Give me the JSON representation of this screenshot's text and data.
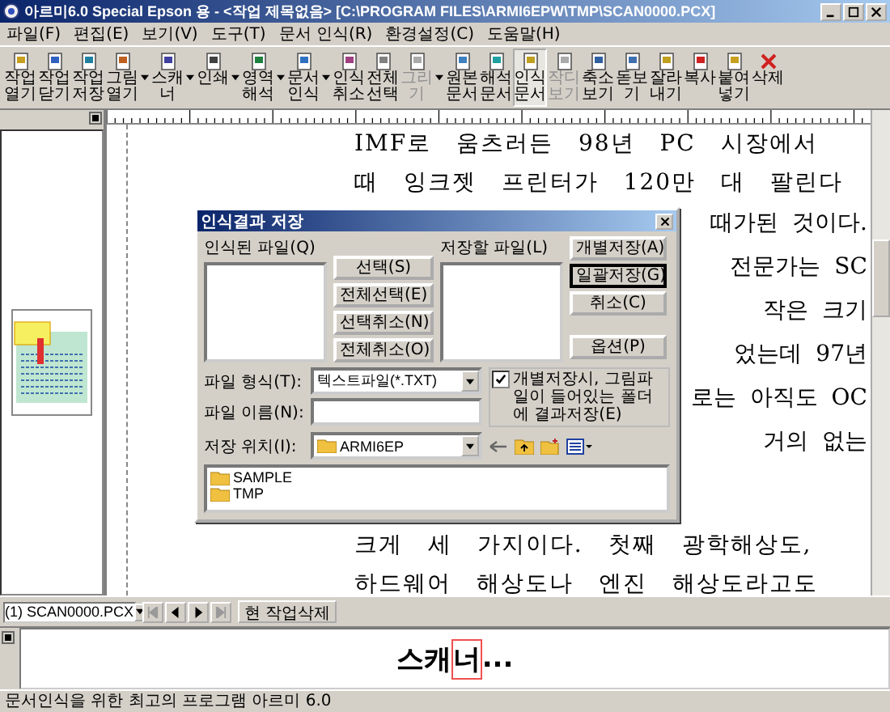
{
  "window": {
    "title": "아르미6.0 Special Epson 용 - <작업 제목없음> [C:\\PROGRAM FILES\\ARMI6EPW\\TMP\\SCAN0000.PCX]"
  },
  "menu": [
    "파일(F)",
    "편집(E)",
    "보기(V)",
    "도구(T)",
    "문서 인식(R)",
    "환경설정(C)",
    "도움말(H)"
  ],
  "toolbar": [
    {
      "kind": "button",
      "label": "작업열기",
      "selected": false,
      "disabled": false
    },
    {
      "kind": "button",
      "label": "작업닫기",
      "selected": false,
      "disabled": false
    },
    {
      "kind": "button",
      "label": "작업저장",
      "selected": false,
      "disabled": false
    },
    {
      "kind": "button",
      "label": "그림열기",
      "selected": false,
      "disabled": false
    },
    {
      "kind": "dropdown"
    },
    {
      "kind": "button",
      "label": "스캐너",
      "selected": false,
      "disabled": false
    },
    {
      "kind": "dropdown"
    },
    {
      "kind": "button",
      "label": "인쇄",
      "selected": false,
      "disabled": false
    },
    {
      "kind": "dropdown"
    },
    {
      "kind": "button",
      "label": "영역해석",
      "selected": false,
      "disabled": false
    },
    {
      "kind": "dropdown"
    },
    {
      "kind": "button",
      "label": "문서인식",
      "selected": false,
      "disabled": false
    },
    {
      "kind": "dropdown"
    },
    {
      "kind": "button",
      "label": "인식취소",
      "selected": false,
      "disabled": false
    },
    {
      "kind": "button",
      "label": "전체선택",
      "selected": false,
      "disabled": false
    },
    {
      "kind": "button",
      "label": "그리기",
      "selected": false,
      "disabled": true
    },
    {
      "kind": "dropdown"
    },
    {
      "kind": "button",
      "label": "원본문서",
      "selected": false,
      "disabled": false
    },
    {
      "kind": "button",
      "label": "해석문서",
      "selected": false,
      "disabled": false
    },
    {
      "kind": "button",
      "label": "인식문서",
      "selected": true,
      "disabled": false
    },
    {
      "kind": "button",
      "label": "작디보기",
      "selected": false,
      "disabled": true
    },
    {
      "kind": "button",
      "label": "축소보기",
      "selected": false,
      "disabled": false
    },
    {
      "kind": "button",
      "label": "돋보기",
      "selected": false,
      "disabled": false
    },
    {
      "kind": "button",
      "label": "잘라내기",
      "selected": false,
      "disabled": false
    },
    {
      "kind": "button",
      "label": "복사",
      "selected": false,
      "disabled": false
    },
    {
      "kind": "button",
      "label": "붙여넣기",
      "selected": false,
      "disabled": false
    },
    {
      "kind": "button",
      "label": "삭제",
      "selected": false,
      "disabled": false
    }
  ],
  "document": {
    "lines": [
      {
        "kind": "full",
        "text": "IMF로 움츠러든 98년 PC 시장에서"
      },
      {
        "kind": "full",
        "text": "때 잉크젯 프린터가 120만 대 팔린다"
      },
      {
        "kind": "right",
        "text": "때가된 것이다."
      },
      {
        "kind": "right",
        "text": "전문가는 SC"
      },
      {
        "kind": "right",
        "text": "작은 크기"
      },
      {
        "kind": "right",
        "text": "었는데 97년"
      },
      {
        "kind": "right",
        "text": "로는 아직도 OC"
      },
      {
        "kind": "right",
        "text": "거의 없는"
      },
      {
        "kind": "full",
        "text": "크게 세 가지이다. 첫째 광학해상도,"
      },
      {
        "kind": "full",
        "text": "하드웨어 해상도나 엔진 해상도라고도"
      }
    ]
  },
  "dialog": {
    "title": "인식결과 저장",
    "recognized_label": "인식된 파일(Q)",
    "save_label": "저장할 파일(L)",
    "middle_buttons": [
      "선택(S)",
      "전체선택(E)",
      "선택취소(N)",
      "전체취소(O)"
    ],
    "right_buttons": [
      {
        "label": "개별저장(A)",
        "default": false
      },
      {
        "label": "일괄저장(G)",
        "default": true
      },
      {
        "label": "취소(C)",
        "default": false
      },
      {
        "label": "옵션(P)",
        "default": false
      }
    ],
    "file_type_label": "파일 형식(T):",
    "file_type": "텍스트파일(*.TXT)",
    "checkbox": {
      "label": "개별저장시, 그림파일이 들어있는 폴더에 결과저장(E)",
      "checked": true
    },
    "file_name_label": "파일 이름(N):",
    "location_label": "저장 위치(I):",
    "location": "ARMI6EP",
    "folders": [
      "SAMPLE",
      "TMP"
    ]
  },
  "pagebar": {
    "file": "(1) SCAN0000.PCX",
    "nav": [
      {
        "kind": "first",
        "disabled": true
      },
      {
        "kind": "prev",
        "disabled": false
      },
      {
        "kind": "next",
        "disabled": false
      },
      {
        "kind": "last",
        "disabled": true
      }
    ],
    "delete_button": "현 작업삭제"
  },
  "result": {
    "before": "스캐",
    "cursor": "너",
    "after": "..."
  },
  "status_bar": "문서인식을 위한 최고의 프로그램 아르미 6.0"
}
